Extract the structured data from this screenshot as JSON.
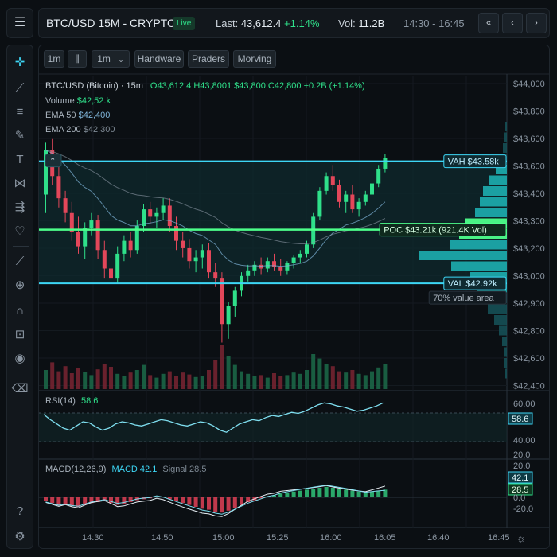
{
  "header": {
    "title": "BTC/USD 15M - CRYPTO",
    "live_badge": "Live",
    "last_label": "Last:",
    "last_value": "43,612.4",
    "last_change": "+1.14%",
    "vol_label": "Vol:",
    "vol_value": "11.2B",
    "time_range": "14:30 - 16:45",
    "nav": {
      "first": "«",
      "prev": "‹",
      "next": "›"
    }
  },
  "toolbar": {
    "interval_btn": "1m",
    "interval_select": "1m",
    "tabs": [
      "Handware",
      "Praders",
      "Morving"
    ]
  },
  "legend": {
    "symbol": "BTC/USD (Bitcoin) · 15m",
    "ohlc": "O43,612.4  H43,8001  $43,800  C42,800  +0.2B (+1.14%)",
    "volume_label": "Volume",
    "volume_value": "$42,52.k",
    "ema50_label": "EMA 50",
    "ema50_value": "$42,400",
    "ema200_label": "EMA 200",
    "ema200_value": "$42,300"
  },
  "profile": {
    "vah_label": "VAH $43.58k",
    "poc_label": "POC $43.21k (921.4K Vol)",
    "val_label": "VAL $42.92k",
    "value_area_note": "70% value area",
    "vah": 43580,
    "poc": 43210,
    "val": 42920
  },
  "colors": {
    "up": "#2fe08a",
    "down": "#e3475a",
    "accent": "#3dd6f5",
    "poc": "#4dff8a"
  },
  "price_axis": [
    "$44,000",
    "$43,800",
    "$43,600",
    "$43,600",
    "$43,400",
    "$43,300",
    "$43,200",
    "$43,000",
    "$42,900",
    "$42,800",
    "$42,600",
    "$42,400"
  ],
  "rsi": {
    "label": "RSI(14)",
    "value": "58.6",
    "axis": [
      "60.00",
      "40.00",
      "20.0"
    ]
  },
  "macd": {
    "label": "MACD(12,26,9)",
    "macd_label": "MACD 42.1",
    "signal_label": "Signal 28.5",
    "macd_value": "42.1",
    "signal_value": "28.5",
    "axis": [
      "20.0",
      "0.0",
      "-20.0"
    ]
  },
  "time_axis": [
    "14:30",
    "14:50",
    "15:00",
    "15:25",
    "16:00",
    "16:05",
    "16:40",
    "16:45"
  ],
  "sidebar": {
    "icons": [
      "crosshair-icon",
      "trendline-icon",
      "fib-icon",
      "brush-icon",
      "text-icon",
      "pattern-icon",
      "measure-icon",
      "heart-icon",
      "ruler-icon",
      "zoom-icon",
      "magnet-icon",
      "lock-icon",
      "eye-icon",
      "trash-icon",
      "help-icon",
      "settings-icon"
    ]
  },
  "chart_data": {
    "type": "candlestick",
    "timeframe": "15m",
    "y_range": [
      42400,
      44000
    ],
    "candles_note": "approximate OHLC traced from image",
    "candles": [
      [
        43400,
        43680,
        43300,
        43640
      ],
      [
        43640,
        43700,
        43450,
        43500
      ],
      [
        43500,
        43560,
        43330,
        43380
      ],
      [
        43380,
        43420,
        43250,
        43300
      ],
      [
        43300,
        43360,
        43150,
        43200
      ],
      [
        43200,
        43280,
        43080,
        43120
      ],
      [
        43120,
        43250,
        43050,
        43220
      ],
      [
        43220,
        43300,
        43180,
        43260
      ],
      [
        43260,
        43290,
        43050,
        43100
      ],
      [
        43100,
        43150,
        42950,
        43000
      ],
      [
        43000,
        43080,
        42900,
        42950
      ],
      [
        42950,
        43120,
        42920,
        43080
      ],
      [
        43080,
        43180,
        43040,
        43150
      ],
      [
        43150,
        43200,
        43060,
        43100
      ],
      [
        43100,
        43260,
        43080,
        43230
      ],
      [
        43230,
        43350,
        43200,
        43320
      ],
      [
        43320,
        43360,
        43240,
        43280
      ],
      [
        43280,
        43330,
        43220,
        43300
      ],
      [
        43300,
        43380,
        43260,
        43340
      ],
      [
        43340,
        43380,
        43200,
        43230
      ],
      [
        43230,
        43280,
        43100,
        43150
      ],
      [
        43150,
        43200,
        43060,
        43110
      ],
      [
        43110,
        43160,
        43000,
        43040
      ],
      [
        43040,
        43100,
        42980,
        43060
      ],
      [
        43060,
        43130,
        43000,
        43100
      ],
      [
        43100,
        43140,
        42950,
        42980
      ],
      [
        42980,
        43030,
        42900,
        42950
      ],
      [
        42950,
        42980,
        42600,
        42700
      ],
      [
        42700,
        42820,
        42620,
        42800
      ],
      [
        42800,
        42900,
        42740,
        42880
      ],
      [
        42880,
        42980,
        42850,
        42960
      ],
      [
        42960,
        43020,
        42930,
        42990
      ],
      [
        42990,
        43040,
        42960,
        43020
      ],
      [
        43020,
        43060,
        42970,
        43000
      ],
      [
        43000,
        43060,
        42980,
        43040
      ],
      [
        43040,
        43080,
        42990,
        43010
      ],
      [
        43010,
        43050,
        42960,
        42990
      ],
      [
        42990,
        43040,
        42970,
        43030
      ],
      [
        43030,
        43070,
        43000,
        43060
      ],
      [
        43060,
        43100,
        43030,
        43080
      ],
      [
        43080,
        43150,
        43060,
        43130
      ],
      [
        43130,
        43300,
        43110,
        43280
      ],
      [
        43280,
        43440,
        43260,
        43420
      ],
      [
        43420,
        43520,
        43400,
        43500
      ],
      [
        43500,
        43560,
        43420,
        43450
      ],
      [
        43450,
        43480,
        43330,
        43360
      ],
      [
        43360,
        43420,
        43300,
        43400
      ],
      [
        43400,
        43450,
        43300,
        43320
      ],
      [
        43320,
        43380,
        43280,
        43360
      ],
      [
        43360,
        43420,
        43340,
        43400
      ],
      [
        43400,
        43480,
        43380,
        43460
      ],
      [
        43460,
        43560,
        43440,
        43540
      ],
      [
        43540,
        43620,
        43520,
        43600
      ]
    ]
  }
}
